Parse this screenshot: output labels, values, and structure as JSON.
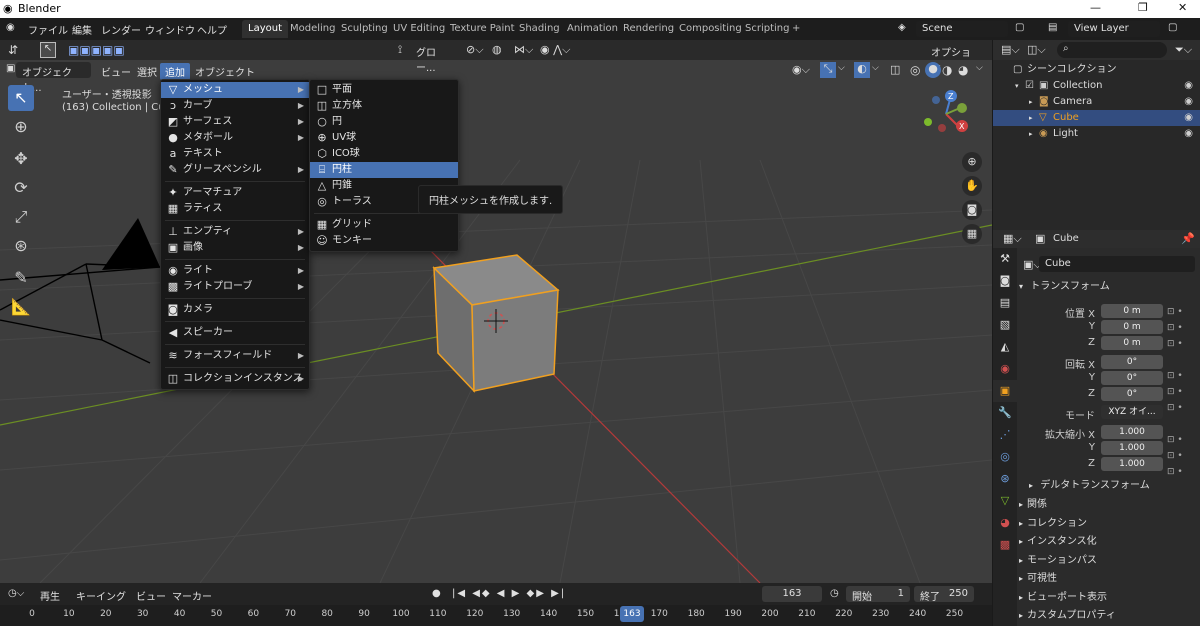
{
  "window": {
    "title": "Blender",
    "controls": [
      "—",
      "❐",
      "✕"
    ]
  },
  "topmenu": [
    "ファイル",
    "編集",
    "レンダー",
    "ウィンドウ",
    "ヘルプ"
  ],
  "workspace_tabs": [
    "Layout",
    "Modeling",
    "Sculpting",
    "UV Editing",
    "Texture Paint",
    "Shading",
    "Animation",
    "Rendering",
    "Compositing",
    "Scripting",
    "+"
  ],
  "active_tab": "Layout",
  "scene": "Scene",
  "view_layer": "View Layer",
  "viewport_header": {
    "mode": "オブジェクト...",
    "menus": [
      "ビュー",
      "選択",
      "追加",
      "オブジェクト"
    ],
    "active_menu": "追加",
    "transform": "グロー...",
    "options": "オプション"
  },
  "overlay_text": {
    "view_name": "ユーザー・透視投影",
    "collection": "(163) Collection | Cube"
  },
  "add_menu": [
    {
      "label": "メッシュ",
      "icon": "▽",
      "sub": true,
      "hl": true
    },
    {
      "label": "カーブ",
      "icon": "ↄ",
      "sub": true
    },
    {
      "label": "サーフェス",
      "icon": "◩",
      "sub": true
    },
    {
      "label": "メタボール",
      "icon": "●",
      "sub": true
    },
    {
      "label": "テキスト",
      "icon": "a",
      "sub": false
    },
    {
      "label": "グリースペンシル",
      "icon": "✎",
      "sub": true
    },
    {
      "sep": true
    },
    {
      "label": "アーマチュア",
      "icon": "✦",
      "sub": false
    },
    {
      "label": "ラティス",
      "icon": "▦",
      "sub": false
    },
    {
      "sep": true
    },
    {
      "label": "エンプティ",
      "icon": "⊥",
      "sub": true
    },
    {
      "label": "画像",
      "icon": "▣",
      "sub": true
    },
    {
      "sep": true
    },
    {
      "label": "ライト",
      "icon": "◉",
      "sub": true
    },
    {
      "label": "ライトプローブ",
      "icon": "▩",
      "sub": true
    },
    {
      "sep": true
    },
    {
      "label": "カメラ",
      "icon": "◙",
      "sub": false
    },
    {
      "sep": true
    },
    {
      "label": "スピーカー",
      "icon": "◀",
      "sub": false
    },
    {
      "sep": true
    },
    {
      "label": "フォースフィールド",
      "icon": "≋",
      "sub": true
    },
    {
      "sep": true
    },
    {
      "label": "コレクションインスタンス",
      "icon": "◫",
      "sub": true
    }
  ],
  "mesh_menu": [
    {
      "label": "平面",
      "icon": "□"
    },
    {
      "label": "立方体",
      "icon": "◫"
    },
    {
      "label": "円",
      "icon": "○"
    },
    {
      "label": "UV球",
      "icon": "⊕"
    },
    {
      "label": "ICO球",
      "icon": "⬡"
    },
    {
      "label": "円柱",
      "icon": "⌸",
      "hl": true
    },
    {
      "label": "円錐",
      "icon": "△"
    },
    {
      "label": "トーラス",
      "icon": "◎"
    },
    {
      "sep": true
    },
    {
      "label": "グリッド",
      "icon": "▦"
    },
    {
      "label": "モンキー",
      "icon": "☺"
    }
  ],
  "tooltip": "円柱メッシュを作成します.",
  "outliner": {
    "title": "シーンコレクション",
    "rows": [
      {
        "name": "Collection",
        "icon": "▣",
        "indent": 1
      },
      {
        "name": "Camera",
        "icon": "◙",
        "indent": 2
      },
      {
        "name": "Cube",
        "icon": "▽",
        "indent": 2,
        "selected": true
      },
      {
        "name": "Light",
        "icon": "◉",
        "indent": 2
      }
    ]
  },
  "properties": {
    "object_name": "Cube",
    "object_field": "Cube",
    "transform_title": "トランスフォーム",
    "location": {
      "label": "位置 X",
      "x": "0 m",
      "y": "0 m",
      "z": "0 m"
    },
    "rotation": {
      "label": "回転 X",
      "x": "0°",
      "y": "0°",
      "z": "0°"
    },
    "mode": {
      "label": "モード",
      "value": "XYZ オイ..."
    },
    "scale": {
      "label": "拡大縮小 X",
      "x": "1.000",
      "y": "1.000",
      "z": "1.000"
    },
    "axis_y": "Y",
    "axis_z": "Z",
    "delta": "デルタトランスフォーム",
    "panels": [
      "関係",
      "コレクション",
      "インスタンス化",
      "モーションパス",
      "可視性",
      "ビューポート表示",
      "カスタムプロパティ"
    ]
  },
  "timeline": {
    "menus": [
      "再生",
      "キーイング",
      "ビュー",
      "マーカー"
    ],
    "current_frame": "163",
    "start_label": "開始",
    "start": "1",
    "end_label": "終了",
    "end": "250",
    "ticks": [
      "0",
      "10",
      "20",
      "30",
      "40",
      "50",
      "60",
      "70",
      "80",
      "90",
      "100",
      "110",
      "120",
      "130",
      "140",
      "150",
      "160",
      "170",
      "180",
      "190",
      "200",
      "210",
      "220",
      "230",
      "240",
      "250"
    ]
  },
  "colors": {
    "accent": "#4772b3",
    "selection_orange": "#f0a020",
    "x_axis": "#b33a3a",
    "y_axis": "#6b8e23"
  }
}
